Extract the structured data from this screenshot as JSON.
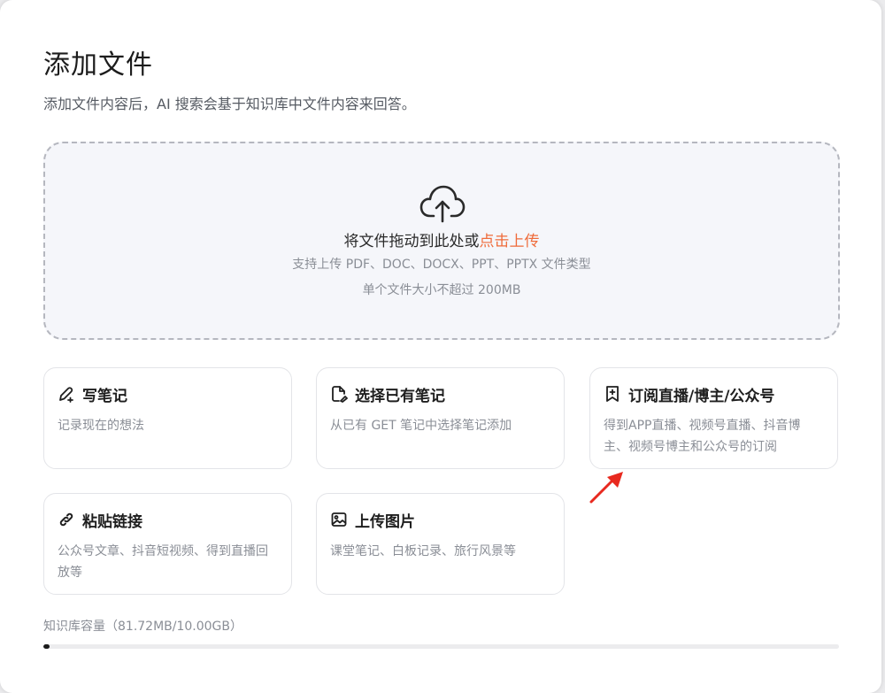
{
  "dialog": {
    "title": "添加文件",
    "subtitle": "添加文件内容后，AI 搜索会基于知识库中文件内容来回答。"
  },
  "dropzone": {
    "icon": "cloud-upload-icon",
    "main_text": "将文件拖动到此处或",
    "link_text": "点击上传",
    "formats_text": "支持上传 PDF、DOC、DOCX、PPT、PPTX 文件类型",
    "size_text": "单个文件大小不超过 200MB",
    "link_color": "#ef6b3a"
  },
  "cards": [
    {
      "icon": "pen-icon",
      "name": "写笔记",
      "desc": "记录现在的想法"
    },
    {
      "icon": "note-icon",
      "name": "选择已有笔记",
      "desc": "从已有 GET 笔记中选择笔记添加"
    },
    {
      "icon": "bookmark-plus-icon",
      "name": "订阅直播/博主/公众号",
      "desc": "得到APP直播、视频号直播、抖音博主、视频号博主和公众号的订阅"
    },
    {
      "icon": "link-icon",
      "name": "粘贴链接",
      "desc": "公众号文章、抖音短视频、得到直播回放等"
    },
    {
      "icon": "image-icon",
      "name": "上传图片",
      "desc": "课堂笔记、白板记录、旅行风景等"
    }
  ],
  "capacity": {
    "label": "知识库容量（81.72MB/10.00GB）",
    "used_fraction": 0.008
  },
  "annotation": {
    "arrow_color": "#e8291f"
  }
}
